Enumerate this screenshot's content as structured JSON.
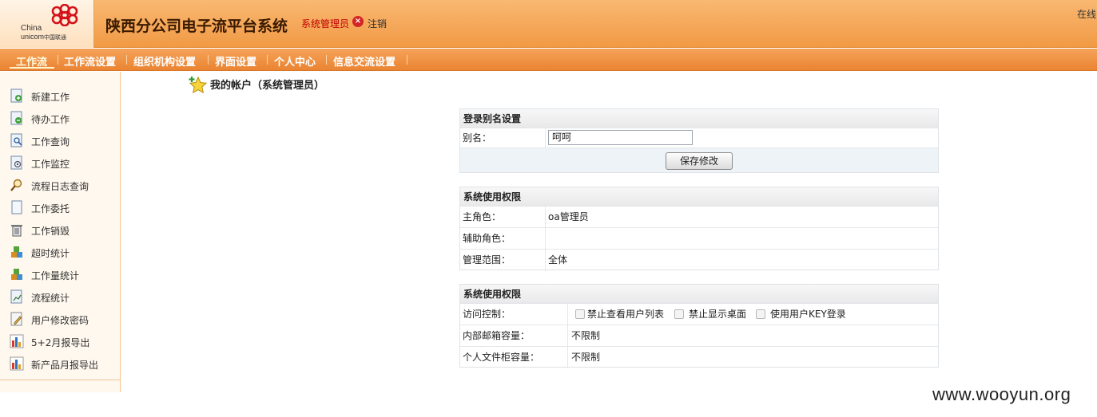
{
  "header": {
    "logo": {
      "line1": "China",
      "line2": "unicom",
      "line2_cn": "中国联通"
    },
    "title": "陕西分公司电子流平台系统",
    "role": "系统管理员",
    "logout": "注销",
    "online": "在线"
  },
  "nav": [
    {
      "label": "工作流",
      "active": true
    },
    {
      "label": "工作流设置"
    },
    {
      "label": "组织机构设置"
    },
    {
      "label": "界面设置"
    },
    {
      "label": "个人中心"
    },
    {
      "label": "信息交流设置"
    }
  ],
  "sidebar": {
    "items": [
      {
        "label": "新建工作",
        "icon": "new-doc-icon"
      },
      {
        "label": "待办工作",
        "icon": "todo-doc-icon"
      },
      {
        "label": "工作查询",
        "icon": "query-doc-icon"
      },
      {
        "label": "工作监控",
        "icon": "monitor-doc-icon"
      },
      {
        "label": "流程日志查询",
        "icon": "magnifier-icon"
      },
      {
        "label": "工作委托",
        "icon": "blank-doc-icon"
      },
      {
        "label": "工作销毁",
        "icon": "trash-icon"
      },
      {
        "label": "超时统计",
        "icon": "blocks-icon"
      },
      {
        "label": "工作量统计",
        "icon": "blocks-icon"
      },
      {
        "label": "流程统计",
        "icon": "chart-doc-icon"
      },
      {
        "label": "用户修改密码",
        "icon": "pencil-doc-icon"
      },
      {
        "label": "5+2月报导出",
        "icon": "bar-chart-icon"
      },
      {
        "label": "新产品月报导出",
        "icon": "bar-chart-icon"
      }
    ]
  },
  "page": {
    "title": "我的帐户（系统管理员）"
  },
  "alias_panel": {
    "heading": "登录别名设置",
    "alias_label": "别名：",
    "alias_value": "呵呵",
    "save_label": "保存修改"
  },
  "permission_panel": {
    "heading": "系统使用权限",
    "rows": [
      {
        "label": "主角色：",
        "value": "oa管理员"
      },
      {
        "label": "辅助角色：",
        "value": ""
      },
      {
        "label": "管理范围：",
        "value": "全体"
      }
    ]
  },
  "access_panel": {
    "heading": "系统使用权限",
    "access_label": "访问控制：",
    "options": [
      {
        "label": "禁止查看用户列表",
        "checked": false
      },
      {
        "label": "禁止显示桌面",
        "checked": false
      },
      {
        "label": "使用用户KEY登录",
        "checked": false
      }
    ],
    "rows": [
      {
        "label": "内部邮箱容量：",
        "value": "不限制"
      },
      {
        "label": "个人文件柜容量：",
        "value": "不限制"
      }
    ]
  },
  "watermark": "www.wooyun.org",
  "colors": {
    "header": "#f19a45",
    "nav": "#ea8432",
    "sidebar": "#fff8ee",
    "role_text": "#c00000"
  }
}
